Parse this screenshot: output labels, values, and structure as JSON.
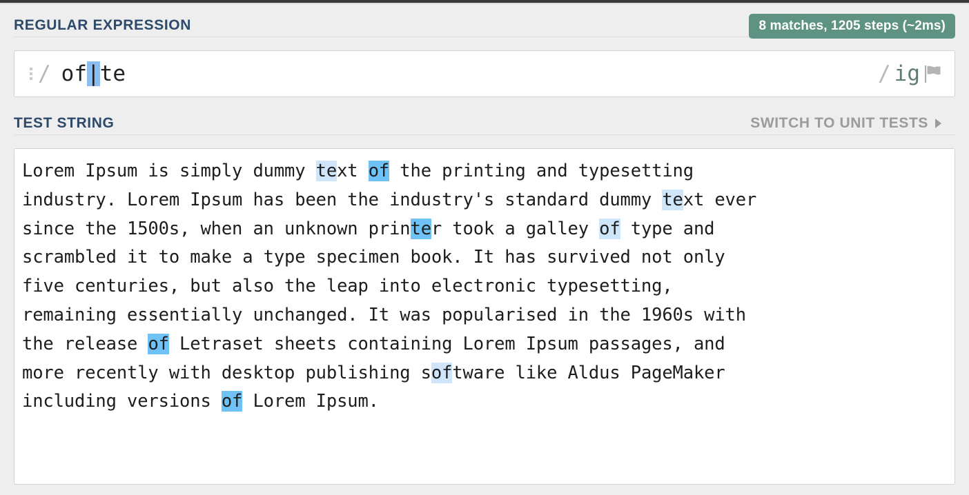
{
  "app": {
    "name": "regexr-regular-expression-tester",
    "accent_green": "#5e9283",
    "header_color": "#2e4a6b",
    "highlight_light": "#cfe6fa",
    "highlight_active": "#6fc2f5",
    "selection_color": "#8cbdf0"
  },
  "regex_section": {
    "title": "REGULAR EXPRESSION",
    "badge": "8 matches, 1205 steps (~2ms)",
    "delimiter_open": "/",
    "delimiter_close": "/",
    "pattern_before": "of",
    "pattern_selected": "|",
    "pattern_after": "te",
    "pattern_full": "of|te",
    "flags": "ig",
    "flag_icon": "flag-icon",
    "drag_handle_icon": "drag-dots-icon"
  },
  "test_section": {
    "title": "TEST STRING",
    "switch_label": "SWITCH TO UNIT TESTS",
    "switch_arrow_icon": "chevron-right-icon",
    "lines": [
      [
        {
          "t": "Lorem Ipsum is simply dummy ",
          "h": "none"
        },
        {
          "t": "te",
          "h": "light"
        },
        {
          "t": "xt ",
          "h": "none"
        },
        {
          "t": "of",
          "h": "active"
        },
        {
          "t": " the printing and typesetting",
          "h": "none"
        }
      ],
      [
        {
          "t": "industry. Lorem Ipsum has been the industry's standard dummy ",
          "h": "none"
        },
        {
          "t": "te",
          "h": "light"
        },
        {
          "t": "xt ever",
          "h": "none"
        }
      ],
      [
        {
          "t": "since the 1500s, when an unknown prin",
          "h": "none"
        },
        {
          "t": "te",
          "h": "active"
        },
        {
          "t": "r took a galley ",
          "h": "none"
        },
        {
          "t": "of",
          "h": "light"
        },
        {
          "t": " type and",
          "h": "none"
        }
      ],
      [
        {
          "t": "scrambled it to make a type specimen book. It has survived not only",
          "h": "none"
        }
      ],
      [
        {
          "t": "five centuries, but also the leap into electronic typesetting,",
          "h": "none"
        }
      ],
      [
        {
          "t": "remaining essentially unchanged. It was popularised in the 1960s with",
          "h": "none"
        }
      ],
      [
        {
          "t": "the release ",
          "h": "none"
        },
        {
          "t": "of",
          "h": "active"
        },
        {
          "t": " Letraset sheets containing Lorem Ipsum passages, and",
          "h": "none"
        }
      ],
      [
        {
          "t": "more recently with desktop publishing s",
          "h": "none"
        },
        {
          "t": "of",
          "h": "light"
        },
        {
          "t": "tware like Aldus PageMaker",
          "h": "none"
        }
      ],
      [
        {
          "t": "including versions ",
          "h": "none"
        },
        {
          "t": "of",
          "h": "active"
        },
        {
          "t": " Lorem Ipsum.",
          "h": "none"
        }
      ]
    ]
  }
}
